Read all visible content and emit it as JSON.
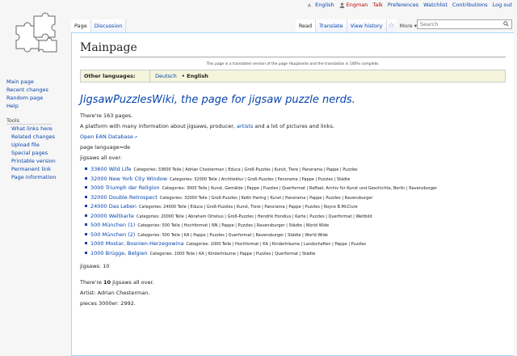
{
  "personal": [
    "English",
    "Engman",
    "Talk",
    "Preferences",
    "Watchlist",
    "Contributions",
    "Log out"
  ],
  "tabs": {
    "page": "Page",
    "discussion": "Discussion",
    "read": "Read",
    "translate": "Translate",
    "history": "View history",
    "more": "More"
  },
  "search": {
    "placeholder": "Search"
  },
  "sidebar": {
    "nav": [
      "Main page",
      "Recent changes",
      "Random page",
      "Help"
    ],
    "tools_heading": "Tools",
    "tools": [
      "What links here",
      "Related changes",
      "Upload file",
      "Special pages",
      "Printable version",
      "Permanent link",
      "Page information"
    ]
  },
  "page": {
    "title": "Mainpage",
    "notice": "This page is a translated version of the page Hauptseite and the translation is 100% complete.",
    "other_languages_label": "Other languages:",
    "languages": [
      "Deutsch",
      "• English"
    ],
    "headline": "JigsawPuzzlesWiki, the page for jigsaw puzzle nerds.",
    "page_count": "There're 163 pages.",
    "platform": "A platform with many information about jigsaws, producer, artists and a lot of pictures and links.",
    "ean_link": "Open EAN Database",
    "language_line": "page language=de",
    "jigsaws_all_over": "jigsaws all over:",
    "jigsaw_count": "jigsaws: 10",
    "summary_pre": "There're ",
    "summary_num": "10",
    "summary_post": " jigsaws all over.",
    "artist": "Artist: Adrian Chesterman.",
    "pieces": "pieces 3000er: 2992."
  },
  "jigsaws": [
    {
      "name": "33600 Wild Life",
      "cats": "Categories: 33600 Teile | Adrian Chesterman | Educa | Groß-Puzzles | Kunst, Tiere | Panorama | Pappe | Puzzles"
    },
    {
      "name": "32000 New York City Window",
      "cats": "Categories: 32000 Teile | Architektur | Groß-Puzzles | Panorama | Pappe | Puzzles | Städte"
    },
    {
      "name": "3000 Triumph der Religion",
      "cats": "Categories: 3000 Teile | Kunst, Gemälde | Pappe | Puzzles | Querformat | Raffael, Archiv für Kunst und Geschichte, Berlin | Ravensburger"
    },
    {
      "name": "32000 Double Retrospect",
      "cats": "Categories: 32000 Teile | Groß-Puzzles | Keith Haring | Kunst | Panorama | Pappe | Puzzles | Ravensburger"
    },
    {
      "name": "24000 Das Leben",
      "cats": "Categories: 24000 Teile | Educa | Groß-Puzzles | Kunst, Tiere | Panorama | Pappe | Puzzles | Royce B.McClure"
    },
    {
      "name": "20000 Weltkarte",
      "cats": "Categories: 20000 Teile | Abraham Ortelius | Groß-Puzzles | Hendrik Hondius | Karte | Puzzles | Querformat | Weltbild"
    },
    {
      "name": "500 München (1)",
      "cats": "Categories: 500 Teile | Hochformat | NN | Pappe | Puzzles | Ravensburger | Städte | World Wide"
    },
    {
      "name": "500 München (2)",
      "cats": "Categories: 500 Teile | KA | Pappe | Puzzles | Querformat | Ravensburger | Städte | World Wide"
    },
    {
      "name": "1000 Mostar, Bosnien-Herzegowina",
      "cats": "Categories: 1000 Teile | Hochformat | KA | Kinderträume | Landschaften | Pappe | Puzzles"
    },
    {
      "name": "1000 Brügge, Belgien",
      "cats": "Categories: 1000 Teile | KA | Kinderträume | Pappe | Puzzles | Querformat | Städte"
    }
  ]
}
